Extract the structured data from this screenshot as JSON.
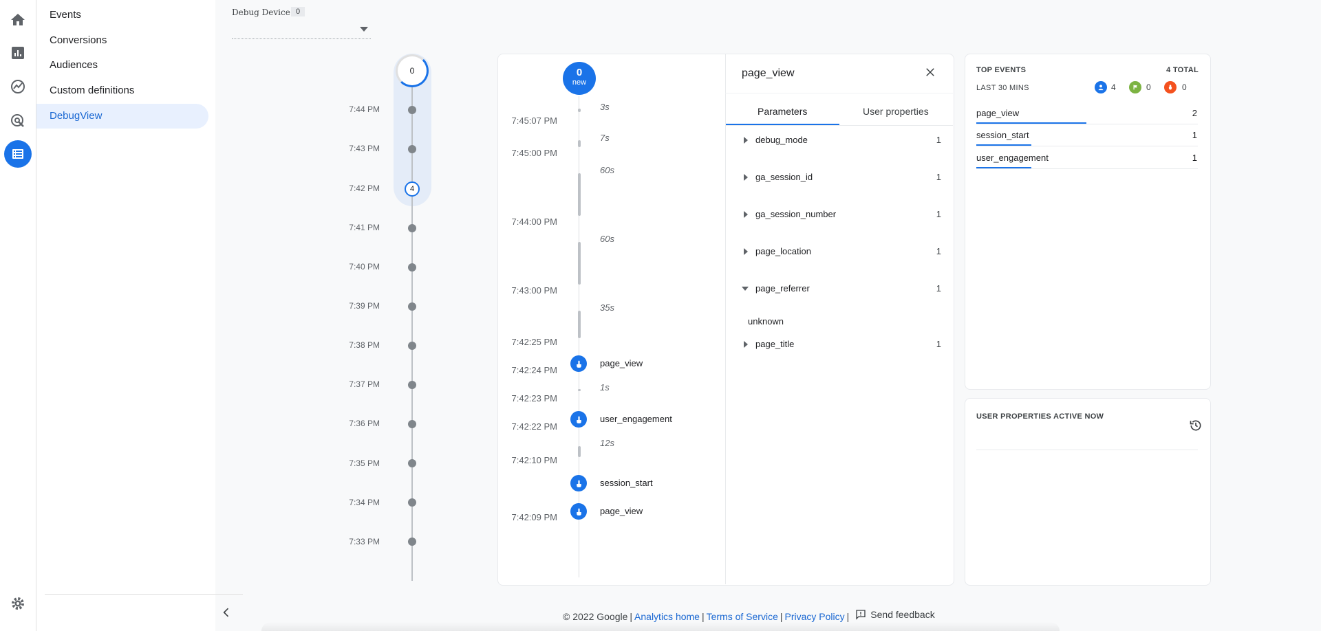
{
  "nav": {
    "items": [
      {
        "label": "Events"
      },
      {
        "label": "Conversions"
      },
      {
        "label": "Audiences"
      },
      {
        "label": "Custom definitions"
      },
      {
        "label": "DebugView"
      }
    ]
  },
  "device": {
    "label": "Debug Device",
    "count": "0"
  },
  "minutes": {
    "top_count": "0",
    "highlight_count": "4",
    "labels": [
      "7:44 PM",
      "7:43 PM",
      "7:42 PM",
      "7:41 PM",
      "7:40 PM",
      "7:39 PM",
      "7:38 PM",
      "7:37 PM",
      "7:36 PM",
      "7:35 PM",
      "7:34 PM",
      "7:33 PM"
    ]
  },
  "seconds": {
    "new_count": "0",
    "new_label": "new",
    "timestamps": [
      "7:45:07 PM",
      "7:45:00 PM",
      "7:44:00 PM",
      "7:43:00 PM",
      "7:42:25 PM",
      "7:42:24 PM",
      "7:42:23 PM",
      "7:42:22 PM",
      "7:42:10 PM",
      "7:42:09 PM"
    ],
    "gaps": [
      "3s",
      "7s",
      "60s",
      "60s",
      "35s",
      "1s",
      "12s"
    ],
    "events": [
      "page_view",
      "user_engagement",
      "session_start",
      "page_view"
    ]
  },
  "params": {
    "title": "page_view",
    "tabs": [
      "Parameters",
      "User properties"
    ],
    "rows": [
      {
        "name": "debug_mode",
        "count": "1"
      },
      {
        "name": "ga_session_id",
        "count": "1"
      },
      {
        "name": "ga_session_number",
        "count": "1"
      },
      {
        "name": "page_location",
        "count": "1"
      },
      {
        "name": "page_referrer",
        "count": "1"
      },
      {
        "name": "page_title",
        "count": "1"
      }
    ],
    "expanded_value": "unknown"
  },
  "top_events": {
    "title": "TOP EVENTS",
    "total": "4 TOTAL",
    "period": "LAST 30 MINS",
    "counts": {
      "users": "4",
      "conversions": "0",
      "errors": "0"
    },
    "rows": [
      {
        "name": "page_view",
        "count": "2",
        "share": 1.0
      },
      {
        "name": "session_start",
        "count": "1",
        "share": 0.5
      },
      {
        "name": "user_engagement",
        "count": "1",
        "share": 0.5
      }
    ]
  },
  "user_props": {
    "title": "USER PROPERTIES ACTIVE NOW"
  },
  "footer": {
    "copyright": "© 2022 Google",
    "links": [
      "Analytics home",
      "Terms of Service",
      "Privacy Policy"
    ],
    "feedback": "Send feedback"
  },
  "colors": {
    "accent": "#1a73e8",
    "conversion": "#7cb342",
    "error": "#f4511e"
  }
}
